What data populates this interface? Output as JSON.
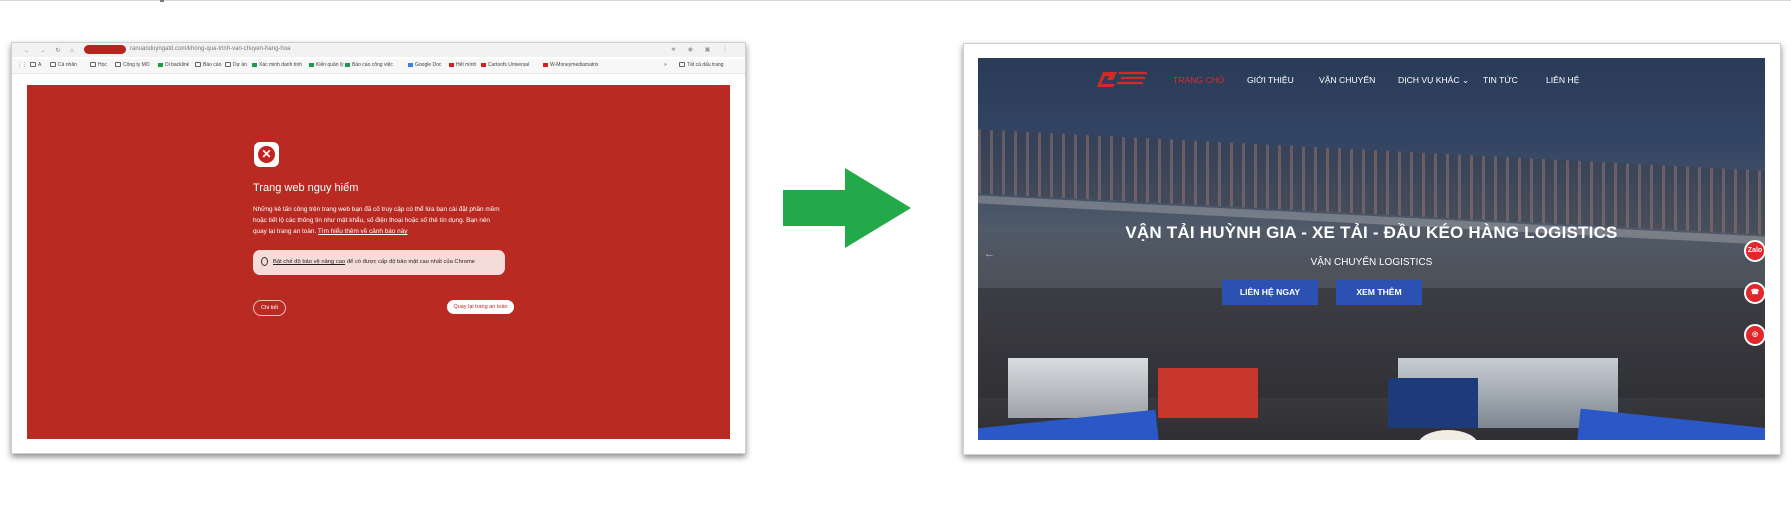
{
  "left_screenshot": {
    "browser": {
      "url": "ranuanduyngatd.com/khong-qua-trinh-van-chuyen-hang-hoa",
      "bookmarks": [
        "A",
        "Cá nhân",
        "Học",
        "Công ty MO",
        "Di backlink",
        "Báo cáo",
        "Dự án",
        "Xác minh danh tính",
        "Kiến quản lý",
        "Báo cáo công việc",
        "Google Doc",
        "Hết mình",
        "Cartoofs Universal",
        "W-Moneymediamatrix",
        "»",
        "Tất cả dấu trang"
      ]
    },
    "warning": {
      "title": "Trang web nguy hiểm",
      "body": "Những kẻ tấn công trên trang web bạn đã cố truy cập có thể lừa bạn cài đặt phần mềm hoặc tiết lộ các thông tin như mật khẩu, số điện thoại hoặc số thẻ tín dụng. Bạn nên quay lại trang an toàn.",
      "learn_more": "Tìm hiểu thêm về cảnh báo này",
      "protection_link": "Bật chế độ bảo vệ nâng cao",
      "protection_text": " để có được cấp độ bảo mật cao nhất của Chrome",
      "details_button": "Chi tiết",
      "back_button": "Quay lại trang an toàn",
      "danger_color": "#b82a22"
    }
  },
  "arrow": {
    "color": "#22aa4a",
    "icon": "right-arrow-icon"
  },
  "right_screenshot": {
    "nav": {
      "items": [
        "TRANG CHỦ",
        "GIỚI THIỆU",
        "VẬN CHUYỂN",
        "DỊCH VỤ KHÁC",
        "TIN TỨC",
        "LIÊN HỆ"
      ],
      "dropdown_marker": "⌄",
      "active_color": "#e02a2a"
    },
    "hero": {
      "title": "VẬN TẢI HUỲNH GIA - XE TẢI - ĐẦU KÉO HÀNG LOGISTICS",
      "subtitle": "VẬN CHUYỂN LOGISTICS",
      "primary_button": "LIÊN HỆ NGAY",
      "secondary_button": "XEM THÊM",
      "button_color": "#2b52b3"
    },
    "floating_buttons": [
      {
        "label": "Zalo",
        "icon": "zalo-icon"
      },
      {
        "label": "☎",
        "icon": "phone-icon"
      },
      {
        "label": "◎",
        "icon": "messenger-icon"
      }
    ],
    "slider_prev": "←"
  }
}
